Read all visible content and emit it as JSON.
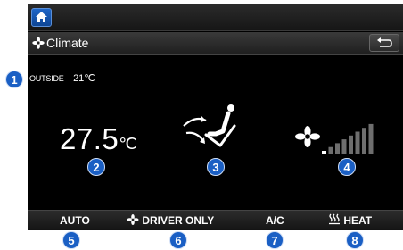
{
  "header": {
    "title": "Climate"
  },
  "outside": {
    "label": "OUTSIDE",
    "temperature": "21℃"
  },
  "cabin": {
    "temperature": "27.5",
    "unit": "℃"
  },
  "fan": {
    "level": 1,
    "max_level": 8
  },
  "bottom": {
    "auto": "AUTO",
    "driver_only": "DRIVER ONLY",
    "ac": "A/C",
    "heat": "HEAT"
  },
  "callouts": [
    "1",
    "2",
    "3",
    "4",
    "5",
    "6",
    "7",
    "8"
  ],
  "colors": {
    "accent": "#1a5fc4",
    "background": "#000000",
    "text": "#ffffff"
  },
  "icons": {
    "home": "home-icon",
    "title": "fan-icon",
    "back": "back-arrow-icon",
    "vent": "air-flow-seat-icon",
    "fan": "fan-icon",
    "heat": "heat-waves-icon"
  }
}
